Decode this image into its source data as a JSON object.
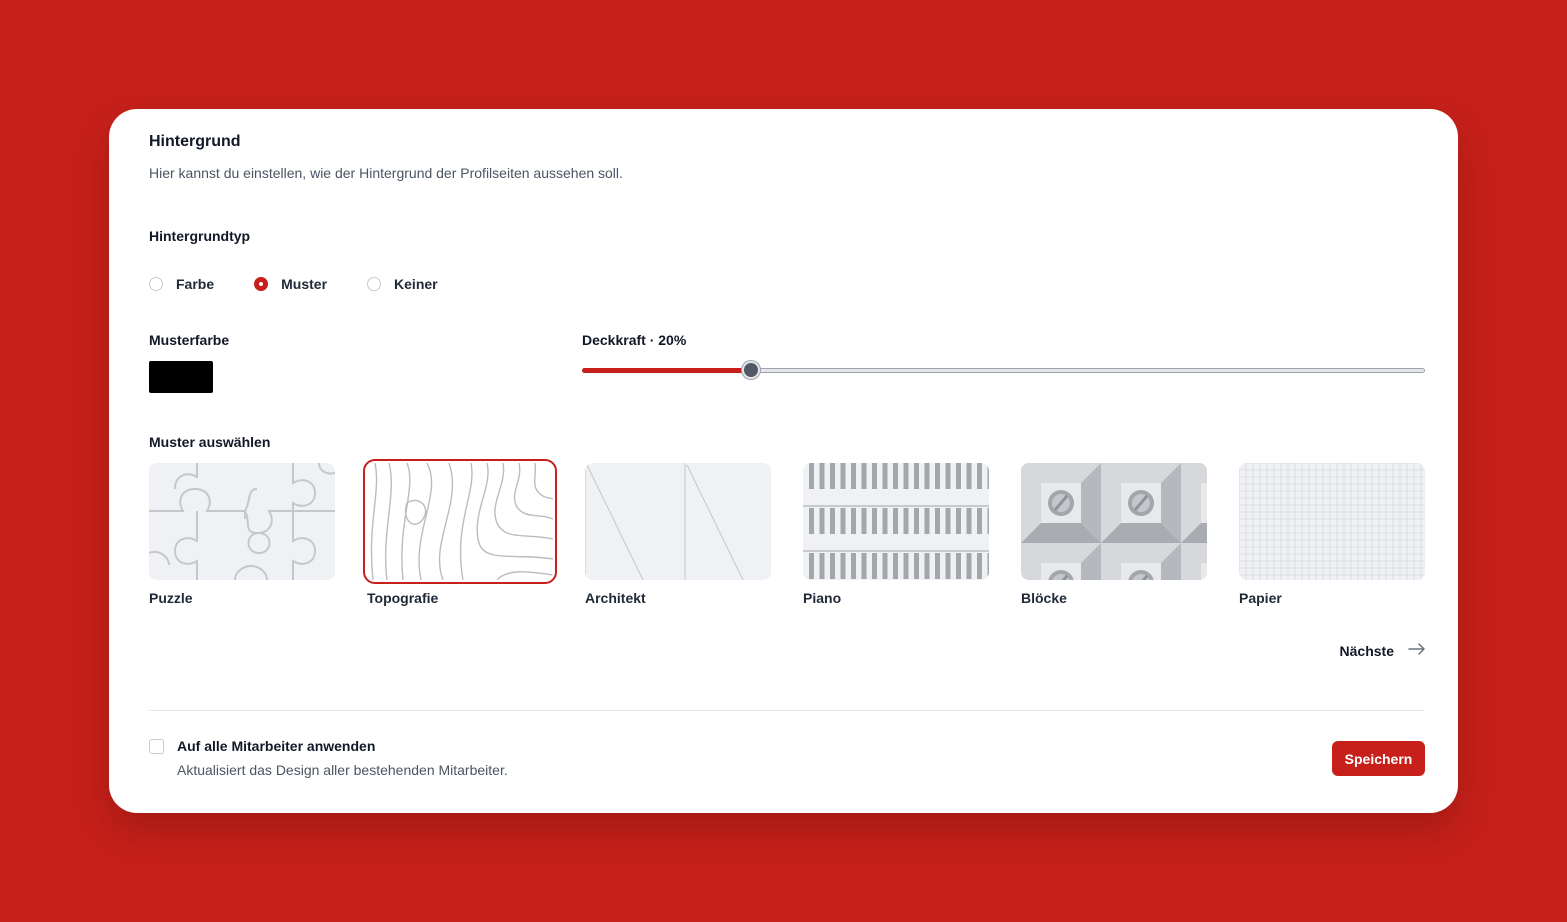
{
  "card": {
    "title": "Hintergrund",
    "description": "Hier kannst du einstellen, wie der Hintergrund der Profilseiten aussehen soll."
  },
  "background_type": {
    "label": "Hintergrundtyp",
    "options": [
      "Farbe",
      "Muster",
      "Keiner"
    ],
    "selected": "Muster"
  },
  "pattern_color": {
    "label": "Musterfarbe",
    "value": "#000000"
  },
  "opacity": {
    "label": "Deckkraft · 20%",
    "value_percent": 20
  },
  "patterns": {
    "label": "Muster auswählen",
    "items": [
      {
        "name": "Puzzle",
        "icon": "puzzle-pattern"
      },
      {
        "name": "Topografie",
        "icon": "topography-pattern"
      },
      {
        "name": "Architekt",
        "icon": "architect-pattern"
      },
      {
        "name": "Piano",
        "icon": "piano-pattern"
      },
      {
        "name": "Blöcke",
        "icon": "blocks-pattern"
      },
      {
        "name": "Papier",
        "icon": "paper-pattern"
      }
    ],
    "selected": "Topografie",
    "next_label": "Nächste"
  },
  "apply_all": {
    "label": "Auf alle Mitarbeiter anwenden",
    "description": "Aktualisiert das Design aller bestehenden Mitarbeiter.",
    "checked": false
  },
  "save_label": "Speichern",
  "colors": {
    "accent": "#c7201a",
    "page_background": "#c7201a",
    "card_background": "#ffffff"
  }
}
